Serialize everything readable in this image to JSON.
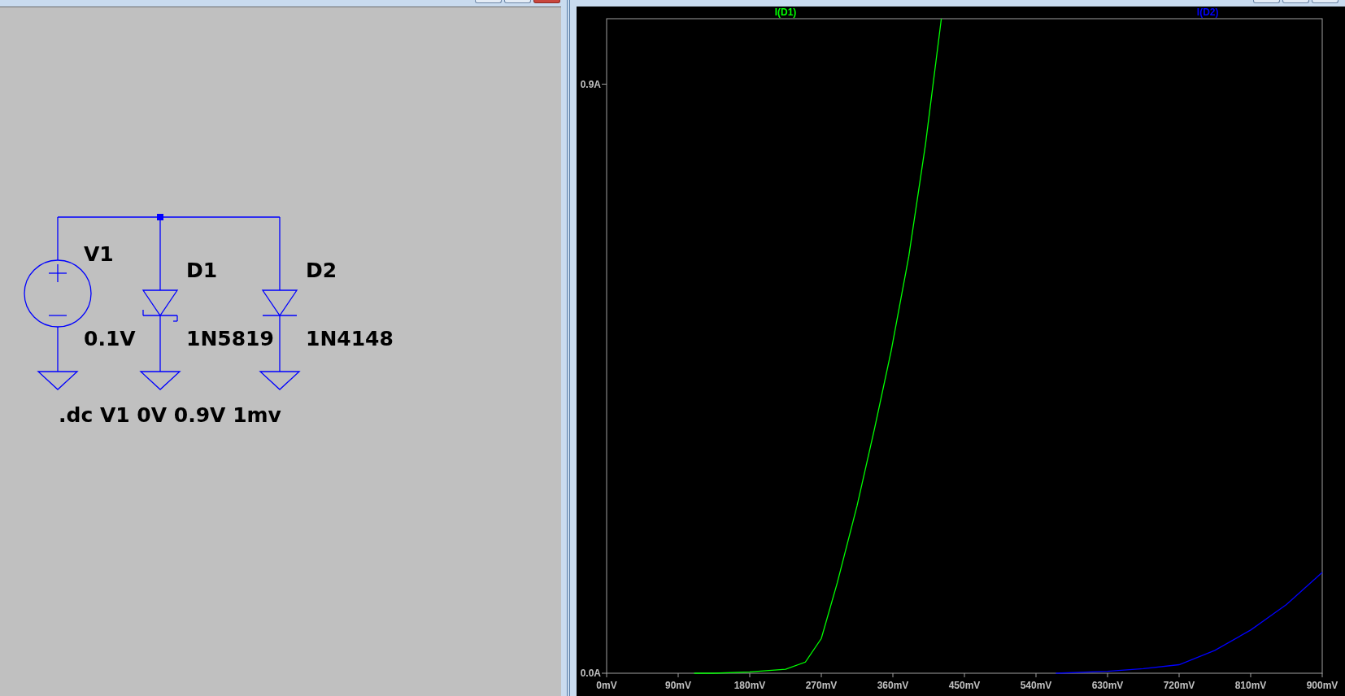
{
  "schematic": {
    "components": [
      {
        "kind": "voltage_source",
        "ref": "V1",
        "value": "0.1V"
      },
      {
        "kind": "schottky_diode",
        "ref": "D1",
        "value": "1N5819"
      },
      {
        "kind": "diode",
        "ref": "D2",
        "value": "1N4148"
      }
    ],
    "directive": ".dc V1 0V 0.9V 1mv"
  },
  "plot": {
    "chart_data": {
      "type": "line",
      "x": [
        110,
        135,
        180,
        225,
        250,
        270,
        290,
        315,
        337,
        358,
        380,
        401,
        421,
        565,
        630,
        675,
        720,
        765,
        810,
        855,
        900
      ],
      "series": [
        {
          "name": "I(D1)",
          "color": "#00ff00",
          "values": [
            0,
            0,
            0.002,
            0.006,
            0.017,
            0.053,
            0.138,
            0.256,
            0.374,
            0.493,
            0.637,
            0.808,
            1.0,
            null,
            null,
            null,
            null,
            null,
            null,
            null,
            null
          ]
        },
        {
          "name": "I(D2)",
          "color": "#0000ff",
          "values": [
            null,
            null,
            null,
            null,
            null,
            null,
            null,
            null,
            null,
            null,
            null,
            null,
            null,
            0,
            0.003,
            0.007,
            0.013,
            0.035,
            0.066,
            0.105,
            0.154
          ]
        }
      ],
      "xlim": [
        0,
        900
      ],
      "ylim": [
        0,
        1.0
      ],
      "xticks": [
        {
          "value": 0,
          "label": "0mV"
        },
        {
          "value": 90,
          "label": "90mV"
        },
        {
          "value": 180,
          "label": "180mV"
        },
        {
          "value": 270,
          "label": "270mV"
        },
        {
          "value": 360,
          "label": "360mV"
        },
        {
          "value": 450,
          "label": "450mV"
        },
        {
          "value": 540,
          "label": "540mV"
        },
        {
          "value": 630,
          "label": "630mV"
        },
        {
          "value": 720,
          "label": "720mV"
        },
        {
          "value": 810,
          "label": "810mV"
        },
        {
          "value": 900,
          "label": "900mV"
        }
      ],
      "yticks": [
        {
          "value": 0,
          "label": "0.0A"
        },
        {
          "value": 0.9,
          "label": "0.9A"
        }
      ]
    }
  }
}
